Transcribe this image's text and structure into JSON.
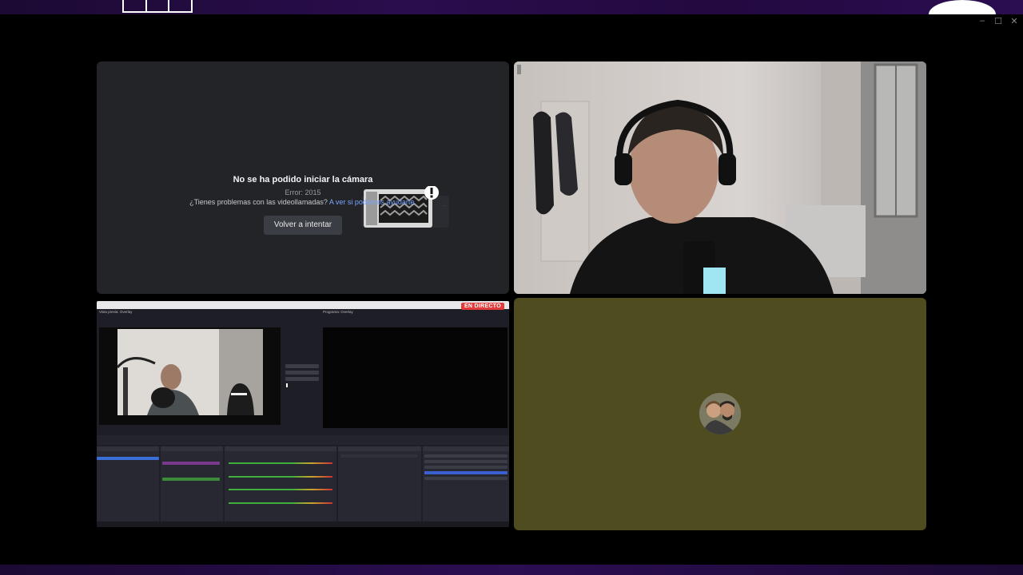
{
  "window": {
    "controls": [
      "–",
      "☐",
      "✕"
    ]
  },
  "error_tile": {
    "title": "No se ha podido iniciar la cámara",
    "error_code": "Error: 2015",
    "help_text": "¿Tienes problemas con las videollamadas?",
    "help_link": "A ver si podemos ayudarte.",
    "retry_button": "Volver a intentar"
  },
  "obs_tile": {
    "live_badge": "EN DIRECTO",
    "preview_label": "Vista previa: Overlay",
    "program_label": "Programa: Overlay"
  },
  "colors": {
    "speaking_border": "#58d262",
    "avatar_tile_bg": "#4f4c1f",
    "error_tile_bg": "#232428",
    "link": "#7aa6ff"
  }
}
